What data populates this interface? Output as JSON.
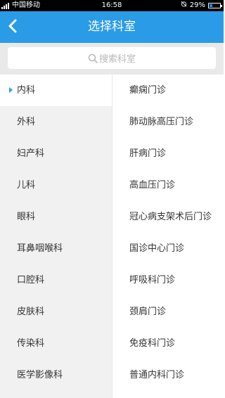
{
  "status_bar": {
    "carrier": "中国移动",
    "time": "16:58",
    "battery_percent": "29%",
    "battery_level": 0.29,
    "signal_icon": "signal-icon",
    "alarm_icon": "alarm-off-icon"
  },
  "header": {
    "title": "选择科室",
    "back_icon": "chevron-left-icon",
    "color": "#2a9be6"
  },
  "search": {
    "placeholder": "搜索科室",
    "icon": "search-icon"
  },
  "departments": [
    {
      "label": "内科",
      "active": true
    },
    {
      "label": "外科"
    },
    {
      "label": "妇产科"
    },
    {
      "label": "儿科"
    },
    {
      "label": "眼科"
    },
    {
      "label": "耳鼻咽喉科"
    },
    {
      "label": "口腔科"
    },
    {
      "label": "皮肤科"
    },
    {
      "label": "传染科"
    },
    {
      "label": "医学影像科"
    }
  ],
  "clinics": [
    {
      "label": "癫痫门诊"
    },
    {
      "label": "肺动脉高压门诊"
    },
    {
      "label": "肝病门诊"
    },
    {
      "label": "高血压门诊"
    },
    {
      "label": "冠心病支架术后门诊"
    },
    {
      "label": "国诊中心门诊"
    },
    {
      "label": "呼吸科门诊"
    },
    {
      "label": "颈肩门诊"
    },
    {
      "label": "免疫科门诊"
    },
    {
      "label": "普通内科门诊"
    }
  ]
}
